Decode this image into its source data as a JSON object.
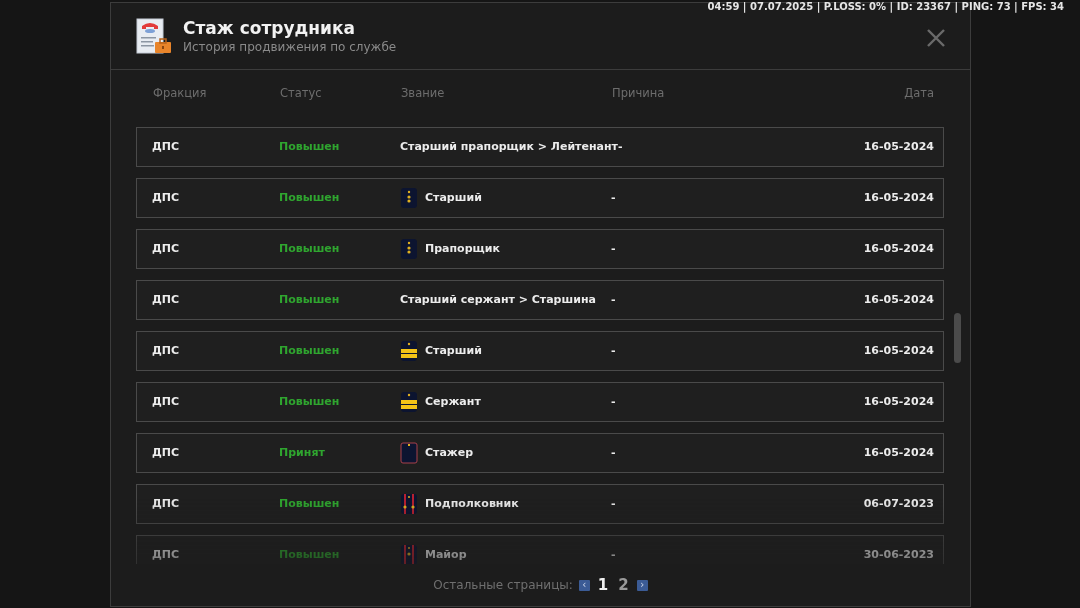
{
  "status_bar": "04:59 | 07.07.2025 | P.LOSS: 0% | ID: 23367 | PING: 73 | FPS: 34",
  "window": {
    "title": "Стаж сотрудника",
    "subtitle": "История продвижения по службе"
  },
  "table": {
    "columns": [
      "Фракция",
      "Статус",
      "Звание",
      "Причина",
      "Дата"
    ],
    "rows": [
      {
        "faction": "ДПС",
        "status": "Повышен",
        "rank": "Старший прапорщик > Лейтенант-",
        "reason": "",
        "date": "16-05-2024"
      },
      {
        "faction": "ДПС",
        "status": "Повышен",
        "kind": "stars",
        "rank": "Старший",
        "reason": "-",
        "date": "16-05-2024"
      },
      {
        "faction": "ДПС",
        "status": "Повышен",
        "kind": "stars",
        "rank": "Прапорщик",
        "reason": "-",
        "date": "16-05-2024"
      },
      {
        "faction": "ДПС",
        "status": "Повышен",
        "rank": "Старший сержант > Старшина",
        "reason": "-",
        "date": "16-05-2024"
      },
      {
        "faction": "ДПС",
        "status": "Повышен",
        "kind": "stripes",
        "rank": "Старший",
        "reason": "-",
        "date": "16-05-2024"
      },
      {
        "faction": "ДПС",
        "status": "Повышен",
        "kind": "stripes",
        "rank": "Сержант",
        "reason": "-",
        "date": "16-05-2024"
      },
      {
        "faction": "ДПС",
        "status": "Принят",
        "kind": "trainee",
        "rank": "Стажер",
        "reason": "-",
        "date": "16-05-2024"
      },
      {
        "faction": "ДПС",
        "status": "Повышен",
        "kind": "officer2",
        "rank": "Подполковник",
        "reason": "-",
        "date": "06-07-2023"
      },
      {
        "faction": "ДПС",
        "status": "Повышен",
        "kind": "officer1",
        "rank": "Майор",
        "reason": "-",
        "date": "30-06-2023"
      }
    ]
  },
  "pagination": {
    "label": "Остальные страницы:",
    "prev": "‹",
    "next": "›",
    "pages": [
      {
        "label": "1",
        "selected": true
      },
      {
        "label": "2",
        "selected": false
      }
    ]
  }
}
